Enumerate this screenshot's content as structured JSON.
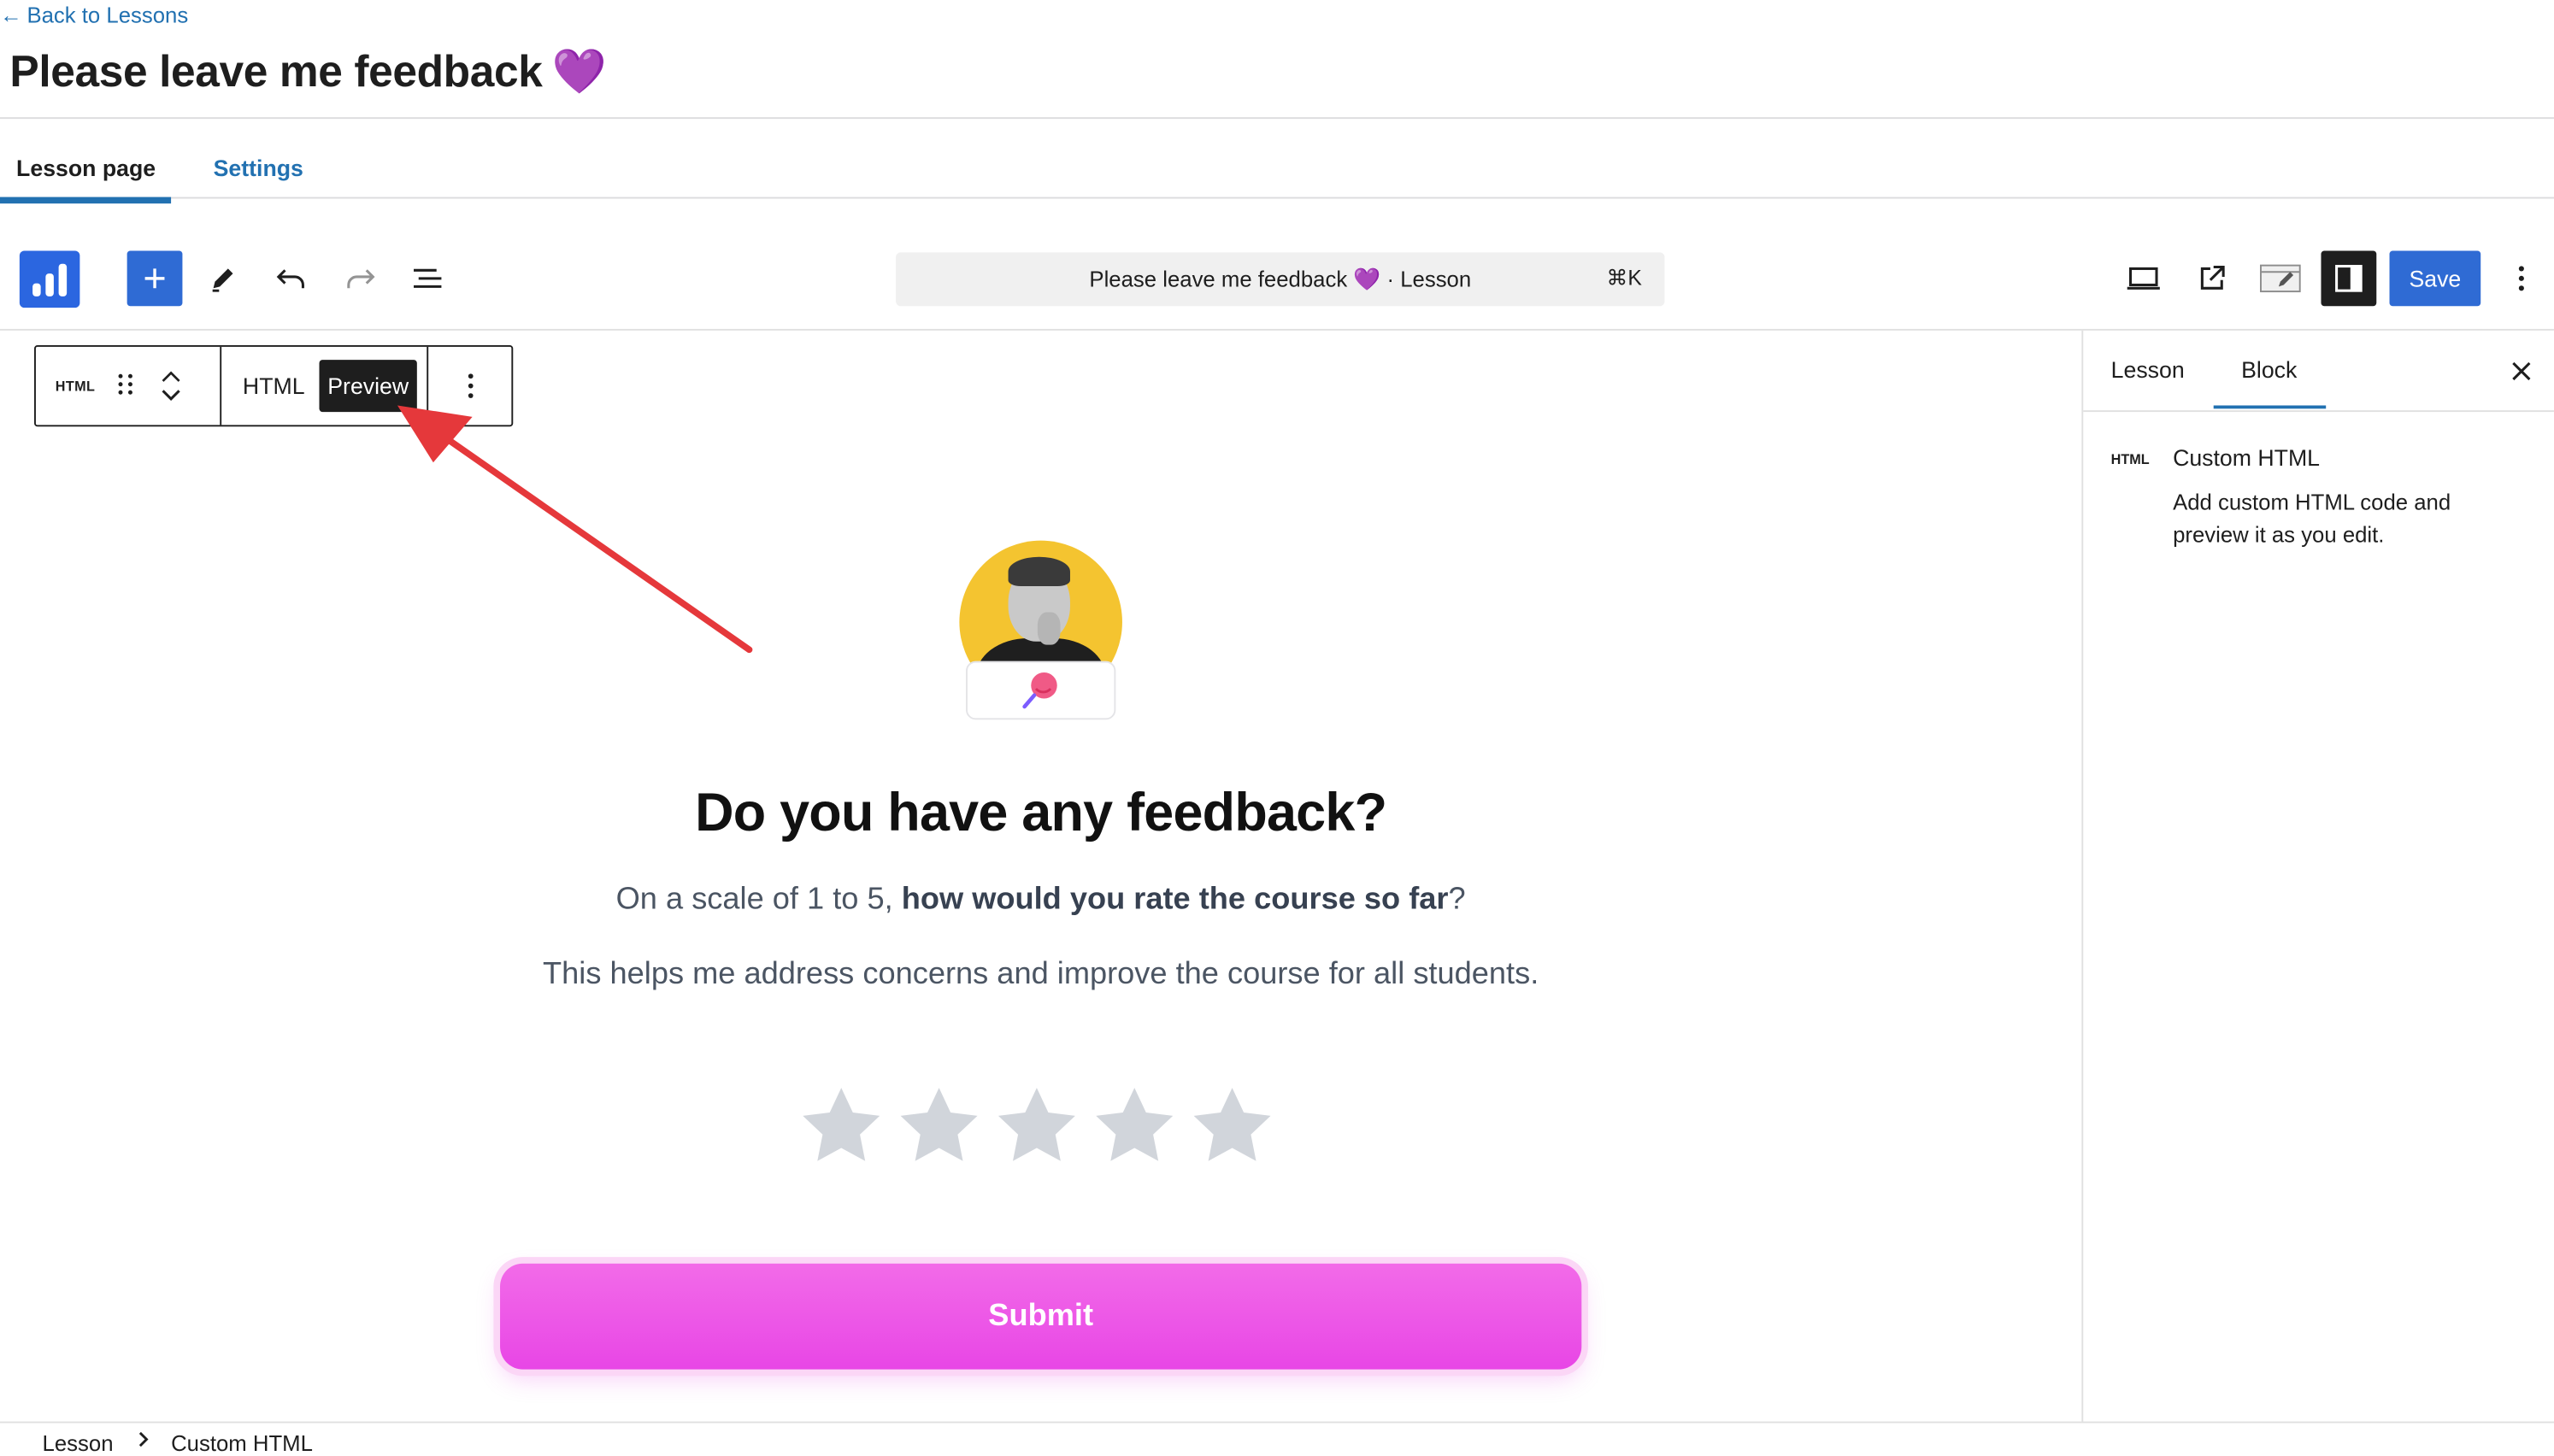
{
  "header": {
    "back_link": "Back to Lessons",
    "title": "Please leave me feedback",
    "title_emoji": "💜"
  },
  "tabs": [
    {
      "label": "Lesson page",
      "active": true
    },
    {
      "label": "Settings",
      "active": false
    }
  ],
  "toolbar": {
    "command_bar_text": "Please leave me feedback 💜 · Lesson",
    "command_shortcut": "⌘K",
    "save_label": "Save",
    "accent_color": "#2f6bd4"
  },
  "block_toolbar": {
    "block_badge": "HTML",
    "html_tab": "HTML",
    "preview_tab": "Preview"
  },
  "preview": {
    "heading": "Do you have any feedback?",
    "subtitle_prefix": "On a scale of 1 to 5, ",
    "subtitle_bold": "how would you rate the course so far",
    "subtitle_suffix": "?",
    "helper_text": "This helps me address concerns and improve the course for all students.",
    "rating": {
      "max": 5,
      "value": 0
    },
    "submit_label": "Submit",
    "submit_color": "#ea52e7"
  },
  "sidebar": {
    "tabs": [
      {
        "label": "Lesson",
        "active": false
      },
      {
        "label": "Block",
        "active": true
      }
    ],
    "block_badge": "HTML",
    "block_title": "Custom HTML",
    "block_description": "Add custom HTML code and preview it as you edit."
  },
  "breadcrumb": [
    "Lesson",
    "Custom HTML"
  ]
}
